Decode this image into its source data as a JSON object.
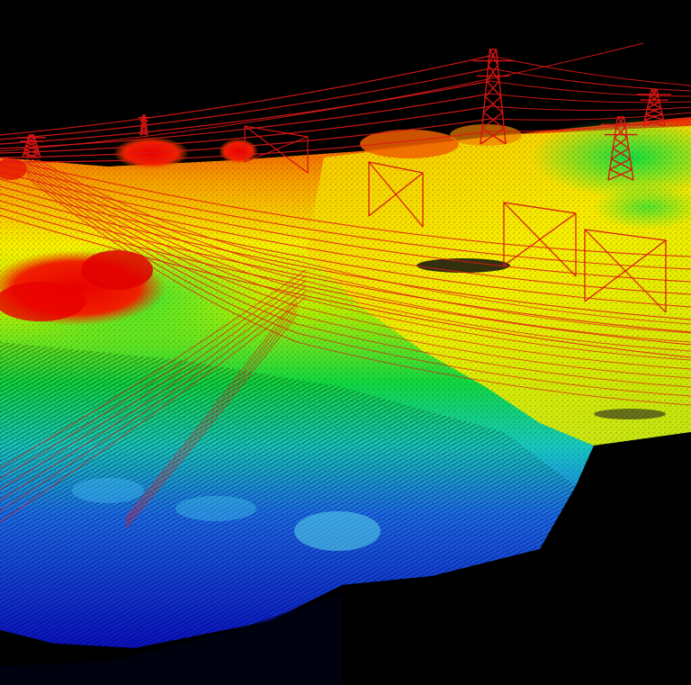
{
  "scene": {
    "subject": "lidar-point-cloud-power-corridor",
    "background_color": "#000000",
    "elevation_palette": [
      "#0a10c8",
      "#1c6cf0",
      "#18c8c0",
      "#10d840",
      "#b8f000",
      "#f8f000",
      "#f8a000",
      "#f03000",
      "#d80000"
    ],
    "wire_color": "#e01818",
    "tower_color": "#d81414"
  }
}
